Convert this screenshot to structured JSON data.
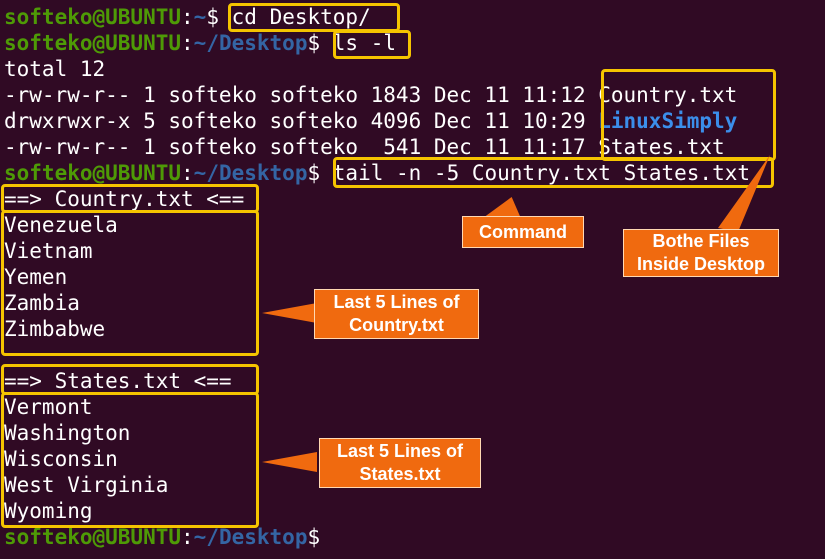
{
  "prompt": {
    "user": "softeko@UBUNTU",
    "colon": ":",
    "home": "~",
    "desktop": "~/Desktop",
    "dollar": "$"
  },
  "commands": {
    "cd": "cd Desktop/",
    "ls": "ls -l",
    "tail": "tail -n -5 Country.txt States.txt"
  },
  "ls_output": {
    "total": "total 12",
    "rows": [
      {
        "meta": "-rw-rw-r-- 1 softeko softeko 1843 Dec 11 11:12 ",
        "name": "Country.txt",
        "is_dir": false
      },
      {
        "meta": "drwxrwxr-x 5 softeko softeko 4096 Dec 11 10:29 ",
        "name": "LinuxSimply",
        "is_dir": true
      },
      {
        "meta": "-rw-rw-r-- 1 softeko softeko  541 Dec 11 11:17 ",
        "name": "States.txt",
        "is_dir": false
      }
    ]
  },
  "country_block": {
    "header": "==> Country.txt <==",
    "lines": [
      "Venezuela",
      "Vietnam",
      "Yemen",
      "Zambia",
      "Zimbabwe"
    ]
  },
  "states_block": {
    "header": "==> States.txt <==",
    "lines": [
      "Vermont",
      "Washington",
      "Wisconsin",
      "West Virginia",
      "Wyoming"
    ]
  },
  "callouts": {
    "command": "Command",
    "files_line1": "Bothe Files",
    "files_line2": "Inside Desktop",
    "country_line1": "Last 5 Lines of",
    "country_line2": "Country.txt",
    "states_line1": "Last 5 Lines of",
    "states_line2": "States.txt"
  },
  "colors": {
    "background": "#300a24",
    "prompt_user": "#4e9a06",
    "prompt_path": "#3465a4",
    "directory": "#3b8eea",
    "highlight": "#f5c400",
    "callout": "#f06a0f"
  }
}
